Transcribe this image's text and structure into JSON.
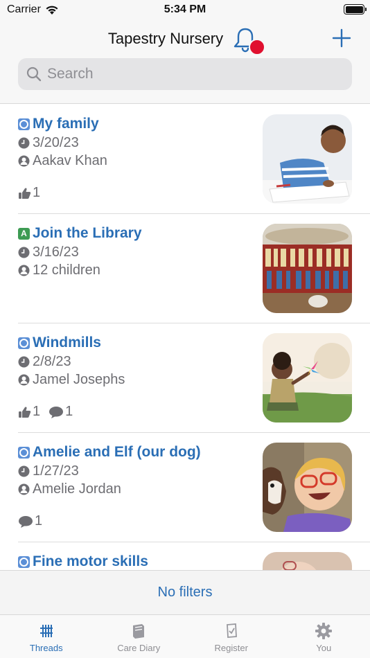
{
  "status_bar": {
    "carrier": "Carrier",
    "time": "5:34 PM"
  },
  "header": {
    "title": "Tapestry Nursery",
    "notification_badge": true,
    "add_icon": "plus-icon"
  },
  "search": {
    "placeholder": "Search",
    "value": ""
  },
  "threads": [
    {
      "type": "observation",
      "title": "My family",
      "date": "3/20/23",
      "person": "Aakav Khan",
      "likes": "1",
      "comments": null
    },
    {
      "type": "activity",
      "type_letter": "A",
      "title": "Join the Library",
      "date": "3/16/23",
      "person": "12 children",
      "likes": null,
      "comments": null
    },
    {
      "type": "observation",
      "title": "Windmills",
      "date": "2/8/23",
      "person": "Jamel Josephs",
      "likes": "1",
      "comments": "1"
    },
    {
      "type": "observation",
      "title": "Amelie and Elf (our dog)",
      "date": "1/27/23",
      "person": "Amelie Jordan",
      "likes": null,
      "comments": "1"
    },
    {
      "type": "observation",
      "title": "Fine motor skills"
    }
  ],
  "filter": {
    "label": "No filters"
  },
  "tabs": [
    {
      "label": "Threads",
      "icon": "threads-icon",
      "active": true
    },
    {
      "label": "Care Diary",
      "icon": "book-icon",
      "active": false
    },
    {
      "label": "Register",
      "icon": "register-icon",
      "active": false
    },
    {
      "label": "You",
      "icon": "gear-icon",
      "active": false
    }
  ],
  "colors": {
    "accent": "#2a6eb5",
    "badge": "#e0102f",
    "secondary_text": "#6d6d72"
  }
}
